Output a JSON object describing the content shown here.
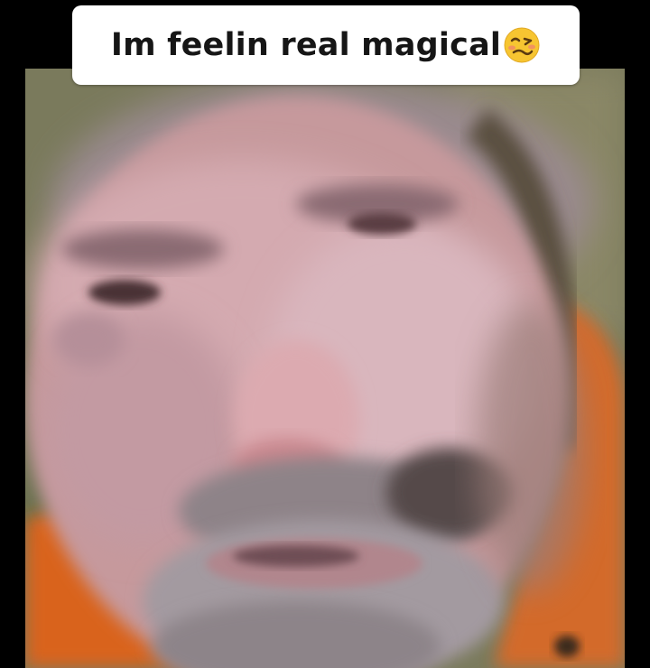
{
  "caption": {
    "text": "Im feelin real magical",
    "emoji": "woozy-face-emoji"
  },
  "colors": {
    "background": "#000000",
    "caption_bg": "#ffffff",
    "caption_text": "#161616",
    "shirt": "#d9641f",
    "skin": "#c99a98",
    "beard": "#9a8f8c"
  },
  "photo": {
    "subject": "blurry-face-closeup"
  }
}
